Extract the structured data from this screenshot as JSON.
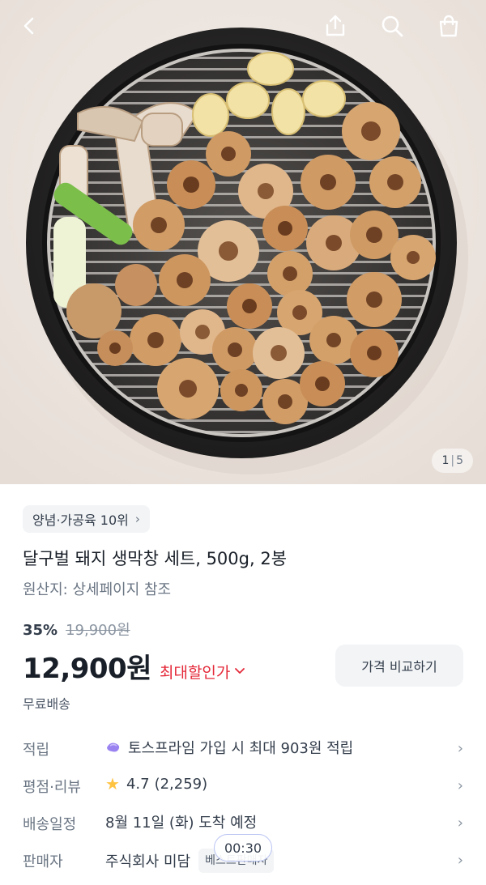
{
  "header": {
    "back_icon": "chevron-left-icon",
    "share_icon": "share-icon",
    "search_icon": "search-icon",
    "cart_icon": "shopping-bag-icon"
  },
  "hero": {
    "image_description_icon": "product-photo",
    "counter_current": "1",
    "counter_sep": "|",
    "counter_total": "5"
  },
  "product": {
    "rank_chip": "양념·가공육 10위",
    "title": "달구벌 돼지 생막창 세트, 500g, 2봉",
    "origin": "원산지: 상세페이지 참조",
    "discount_rate": "35%",
    "original_price": "19,900원",
    "price": "12,900원",
    "max_discount_label": "최대할인가",
    "compare_button": "가격 비교하기",
    "shipping": "무료배송"
  },
  "info_rows": {
    "points": {
      "label": "적립",
      "value": "토스프라임 가입 시 최대 903원 적립"
    },
    "rating": {
      "label": "평점·리뷰",
      "score": "4.7",
      "count": "(2,259)"
    },
    "delivery": {
      "label": "배송일정",
      "value": "8월 11일 (화) 도착 예정"
    },
    "seller": {
      "label": "판매자",
      "value": "주식회사 미담",
      "badge": "베스트판매자"
    }
  },
  "timer": "00:30",
  "colors": {
    "accent_red": "#e42939",
    "star": "#ffc342",
    "text_primary": "#191f28",
    "text_secondary": "#6b7684"
  }
}
